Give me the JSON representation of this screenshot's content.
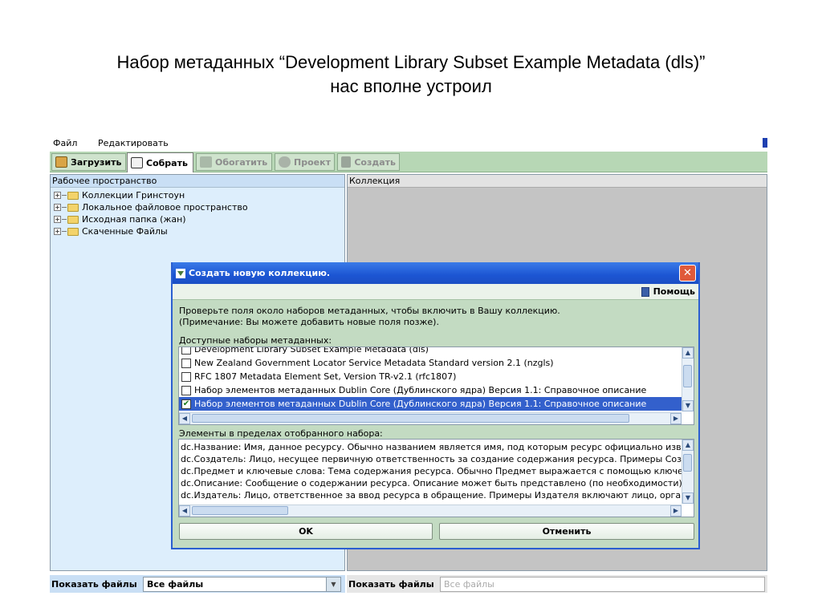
{
  "slide": {
    "title_line1": "Набор метаданных “Development  Library Subset Example Metadata (dls)”",
    "title_line2": "нас вполне устроил"
  },
  "menu": {
    "file": "Файл",
    "edit": "Редактировать"
  },
  "toolbar": {
    "tabs": [
      {
        "label": "Загрузить",
        "icon": "download-icon"
      },
      {
        "label": "Собрать",
        "icon": "gather-icon"
      },
      {
        "label": "Обогатить",
        "icon": "enrich-icon"
      },
      {
        "label": "Проект",
        "icon": "design-icon"
      },
      {
        "label": "Создать",
        "icon": "create-icon"
      }
    ]
  },
  "workspace": {
    "header": "Рабочее пространство",
    "items": [
      "Коллекции Гринстоун",
      "Локальное файловое пространство",
      "Исходная папка (жан)",
      "Скаченные Файлы"
    ]
  },
  "collection": {
    "header": "Коллекция"
  },
  "bottom": {
    "show_files_left": "Показать файлы",
    "filter_left": "Все файлы",
    "show_files_right": "Показать файлы",
    "filter_right": "Все файлы"
  },
  "dialog": {
    "title": "Создать новую коллекцию.",
    "help": "Помощь",
    "instruction_line1": "Проверьте поля около наборов метаданных, чтобы включить в Вашу коллекцию.",
    "instruction_line2": "(Примечание: Вы можете добавить новые поля позже).",
    "available_label": "Доступные наборы метаданных:",
    "sets": [
      {
        "label": "Development Library Subset Example Metadata (dls)",
        "checked": false,
        "selected": false
      },
      {
        "label": "New Zealand Government Locator Service Metadata Standard version 2.1 (nzgls)",
        "checked": false,
        "selected": false
      },
      {
        "label": "RFC 1807 Metadata Element Set, Version TR-v2.1 (rfc1807)",
        "checked": false,
        "selected": false
      },
      {
        "label": "Набор элементов метаданных Dublin Core (Дублинского ядра) Версия 1.1: Справочное описание",
        "checked": false,
        "selected": false
      },
      {
        "label": "Набор элементов метаданных Dublin Core (Дублинского ядра) Версия 1.1: Справочное описание",
        "checked": true,
        "selected": true
      }
    ],
    "elements_label": "Элементы в пределах отобранного набора:",
    "elements": [
      "dc.Название: Имя, данное ресурсу. Обычно названием является имя, под которым ресурс официально известен.",
      "dc.Создатель: Лицо, несущее первичную ответственность за создание содержания ресурса. Примеры Создателя включают лицо.",
      "dc.Предмет и ключевые слова: Тема содержания ресурса. Обычно Предмет выражается с помощью ключевых слов.",
      "dc.Описание: Сообщение о содержании ресурса. Описание может быть представлено (по необходимости) в виде аннотации.",
      "dc.Издатель: Лицо, ответственное за ввод ресурса в обращение. Примеры Издателя включают лицо, организацию."
    ],
    "ok": "OK",
    "cancel": "Отменить"
  }
}
